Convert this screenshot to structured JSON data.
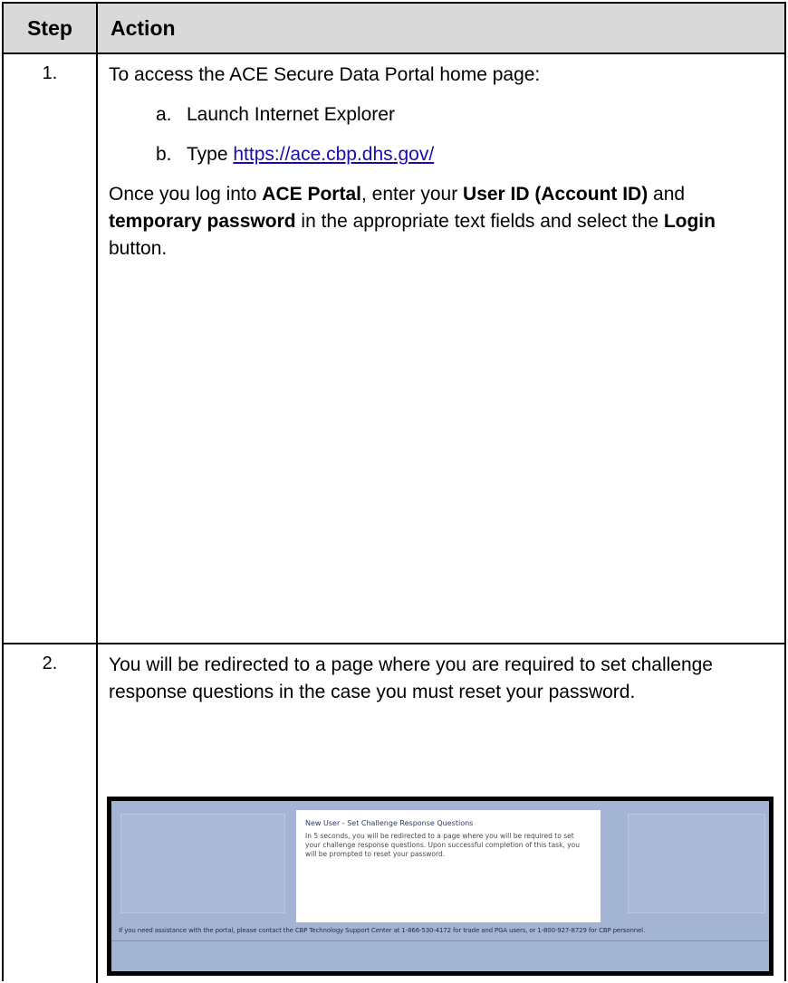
{
  "header": {
    "step_label": "Step",
    "action_label": "Action"
  },
  "rows": [
    {
      "step": "1.",
      "intro": "To access the ACE Secure Data Portal home page:",
      "items": [
        {
          "label": "a.",
          "text": "Launch Internet Explorer"
        },
        {
          "label": "b.",
          "text_prefix": "Type ",
          "link": "https://ace.cbp.dhs.gov/"
        }
      ],
      "instruction": {
        "t1": "Once you log into ",
        "b1": "ACE Portal",
        "t2": ", enter your ",
        "b2": "User ID (Account ID)",
        "t3": " and ",
        "b3": "temporary password",
        "t4": " in the appropriate text fields and select the ",
        "b4": "Login",
        "t5": " button."
      }
    },
    {
      "step": "2.",
      "text": "You will be redirected to a page where you are required to set challenge response questions in the case you must reset your password.",
      "screenshot": {
        "title": "New User - Set Challenge Response Questions",
        "body": "In 5 seconds, you will be redirected to a page where you will be required to set your challenge response questions. Upon successful completion of this task, you will be prompted to reset your password.",
        "assistance": "If you need assistance with the portal, please contact the CBP Technology Support Center at 1-866-530-4172 for trade and PGA users, or 1-800-927-8729 for CBP personnel."
      }
    }
  ]
}
